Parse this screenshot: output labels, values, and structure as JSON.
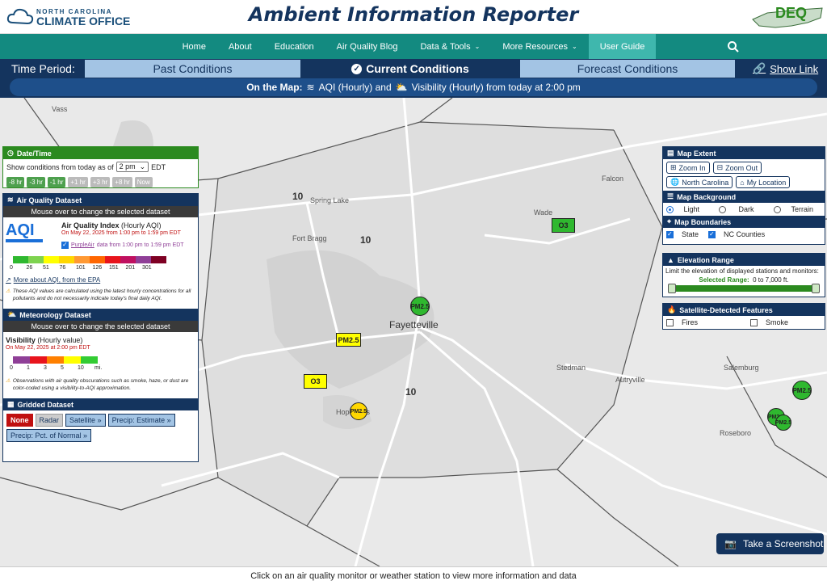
{
  "header": {
    "logo_small": "NORTH CAROLINA",
    "logo_big": "CLIMATE OFFICE",
    "title": "Ambient Information Reporter",
    "deq": "DEQ"
  },
  "nav": {
    "items": [
      "Home",
      "About",
      "Education",
      "Air Quality Blog",
      "Data & Tools",
      "More Resources",
      "User Guide"
    ]
  },
  "time_period": {
    "label": "Time Period:",
    "tabs": [
      "Past Conditions",
      "Current Conditions",
      "Forecast Conditions"
    ],
    "show_link": "Show Link"
  },
  "on_map": {
    "prefix": "On the Map:",
    "aqi": "AQI (Hourly) and",
    "vis": "Visibility (Hourly) from today at 2:00 pm"
  },
  "datetime": {
    "title": "Date/Time",
    "show_text": "Show conditions from today as of",
    "selected": "2 pm",
    "tz": "EDT",
    "buttons": [
      "-8 hr",
      "-3 hr",
      "-1 hr",
      "+1 hr",
      "+3 hr",
      "+8 hr",
      "Now"
    ]
  },
  "aq_dataset": {
    "title": "Air Quality Dataset",
    "sub": "Mouse over to change the selected dataset",
    "name": "Air Quality Index",
    "name_suffix": "(Hourly AQI)",
    "date": "On May 22, 2025 from 1:00 pm to 1:59 pm EDT",
    "purpleair_link": "PurpleAir",
    "purpleair_rest": "data from 1:00 pm to 1:59 pm EDT",
    "scale": [
      "0",
      "26",
      "51",
      "76",
      "101",
      "126",
      "151",
      "201",
      "301"
    ],
    "scale_colors": [
      "#2fb82f",
      "#7ed34f",
      "#ffff00",
      "#ffd700",
      "#ff9933",
      "#ff6600",
      "#e8141c",
      "#c01060",
      "#8f3f97",
      "#7e0023"
    ],
    "more_link": "More about AQI, from the EPA",
    "note": "These AQI values are calculated using the latest hourly concentrations for all pollutants and do not necessarily indicate today's final daily AQI."
  },
  "met_dataset": {
    "title": "Meteorology Dataset",
    "sub": "Mouse over to change the selected dataset",
    "name": "Visibility",
    "name_suffix": "(Hourly value)",
    "date": "On May 22, 2025 at 2:00 pm EDT",
    "scale": [
      "0",
      "1",
      "3",
      "5",
      "10",
      "mi."
    ],
    "scale_colors": [
      "#8f3f97",
      "#e8141c",
      "#ff8000",
      "#ffff00",
      "#33cc33"
    ],
    "note": "Observations with air quality obscurations such as smoke, haze, or dust are color-coded using a visibility-to-AQI approximation."
  },
  "gridded": {
    "title": "Gridded Dataset",
    "buttons": [
      "None",
      "Radar",
      "Satellite",
      "Precip: Estimate",
      "Precip: Pct. of Normal"
    ]
  },
  "extent": {
    "title": "Map Extent",
    "zoom_in": "Zoom In",
    "zoom_out": "Zoom Out",
    "nc": "North Carolina",
    "loc": "My Location"
  },
  "background": {
    "title": "Map Background",
    "options": [
      "Light",
      "Dark",
      "Terrain"
    ]
  },
  "boundaries": {
    "title": "Map Boundaries",
    "options": [
      "State",
      "NC Counties"
    ]
  },
  "elevation": {
    "title": "Elevation Range",
    "text": "Limit the elevation of displayed stations and monitors:",
    "sel_label": "Selected Range:",
    "sel_value": "0 to 7,000 ft."
  },
  "satellite": {
    "title": "Satellite-Detected Features",
    "options": [
      "Fires",
      "Smoke"
    ]
  },
  "map": {
    "cities": [
      "Vass",
      "Spring Lake",
      "Fort Bragg",
      "Fayetteville",
      "Wade",
      "Falcon",
      "Stedman",
      "Autryville",
      "Salemburg",
      "Roseboro",
      "Hope Mills"
    ],
    "highways": [
      "10",
      "10",
      "10"
    ],
    "markers": [
      "O3",
      "PM2.5",
      "PM2.5",
      "O3",
      "PM2.5",
      "PM2.5",
      "PM2.5",
      "PM2.5"
    ]
  },
  "screenshot_label": "Take a Screenshot",
  "footer": "Click on an air quality monitor or weather station to view more information and data"
}
